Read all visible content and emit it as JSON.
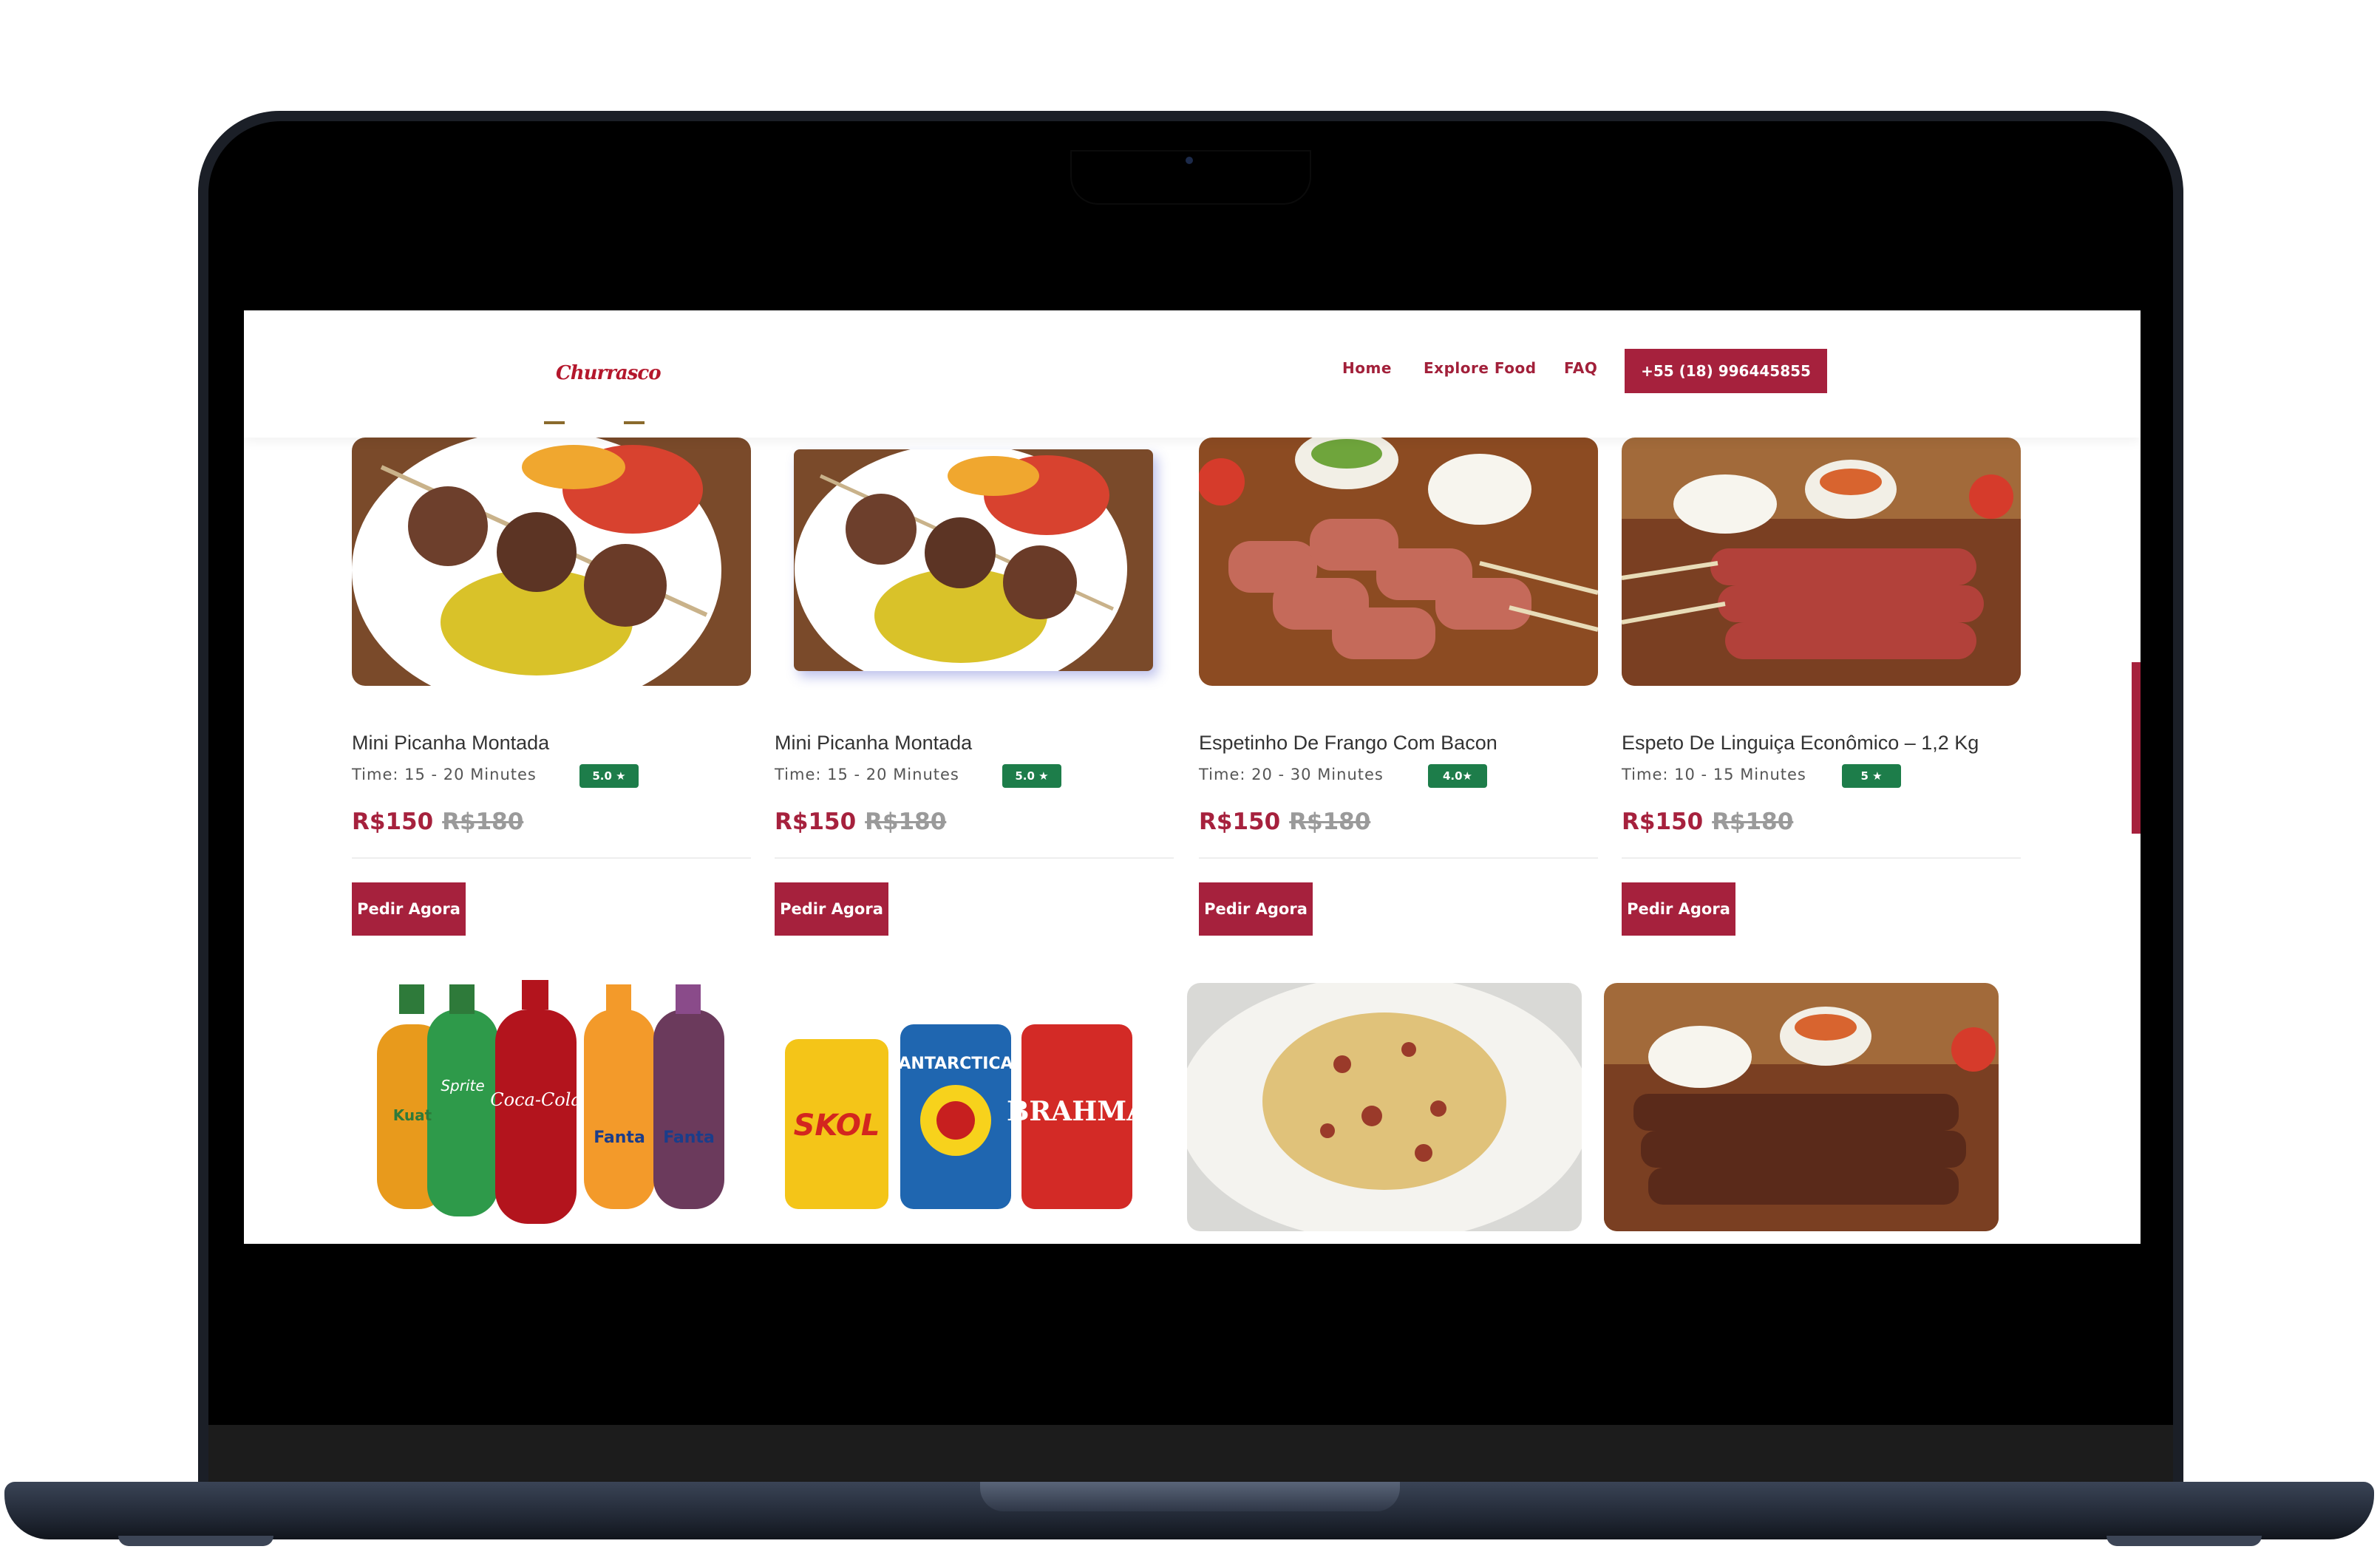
{
  "brand": {
    "logo_text": "Churrasco",
    "accent_color": "#a6213d",
    "rating_color": "#1d7d4a"
  },
  "nav": {
    "links": [
      "Home",
      "Explore Food",
      "FAQ"
    ],
    "phone": "+55 (18) 996445855"
  },
  "products": [
    {
      "title": "Mini Picanha Montada",
      "time": "Time: 15 - 20 Minutes",
      "rating": "5.0 ★",
      "price": "R$150",
      "old_price": "R$180",
      "button": "Pedir Agora",
      "image": "picanha-plate"
    },
    {
      "title": "Mini Picanha Montada",
      "time": "Time: 15 - 20 Minutes",
      "rating": "5.0 ★",
      "price": "R$150",
      "old_price": "R$180",
      "button": "Pedir Agora",
      "image": "picanha-plate"
    },
    {
      "title": "Espetinho De Frango Com Bacon",
      "time": "Time: 20 - 30 Minutes",
      "rating": "4.0★",
      "price": "R$150",
      "old_price": "R$180",
      "button": "Pedir Agora",
      "image": "chicken-bacon-skewers"
    },
    {
      "title": "Espeto De Linguiça Econômico – 1,2 Kg",
      "time": "Time: 10 - 15 Minutes",
      "rating": "5 ★",
      "price": "R$150",
      "old_price": "R$180",
      "button": "Pedir Agora",
      "image": "sausage-skewers"
    }
  ],
  "second_row_images": [
    {
      "image": "soda-bottles",
      "labels": [
        "Kuat",
        "Sprite",
        "Coca-Cola",
        "Fanta",
        "Fanta"
      ]
    },
    {
      "image": "beer-cans",
      "labels": [
        "SKOL",
        "ANTARCTICA",
        "BRAHMA"
      ]
    },
    {
      "image": "farofa-plate"
    },
    {
      "image": "beef-skewers"
    }
  ]
}
